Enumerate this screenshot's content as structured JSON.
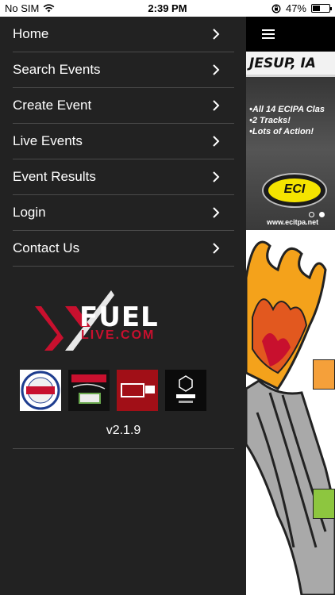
{
  "status_bar": {
    "carrier": "No SIM",
    "time": "2:39 PM",
    "battery_percent": "47%",
    "battery_level": 0.47
  },
  "drawer": {
    "menu": [
      {
        "label": "Home"
      },
      {
        "label": "Search Events"
      },
      {
        "label": "Create Event"
      },
      {
        "label": "Live Events"
      },
      {
        "label": "Event Results"
      },
      {
        "label": "Login"
      },
      {
        "label": "Contact Us"
      }
    ],
    "logo": {
      "main": "FUEL",
      "sub": "LIVE.COM"
    },
    "sponsors": [
      {
        "name": "united-states-pullers-association-logo"
      },
      {
        "name": "beer-money-pulling-team-logo"
      },
      {
        "name": "ppp-tv-logo"
      },
      {
        "name": "mlm-media-logo"
      }
    ],
    "version": "v2.1.9"
  },
  "main": {
    "banner": {
      "city": "JESUP, IA",
      "lines": [
        "•All 14 ECIPA Clas",
        "•2 Tracks!",
        "•Lots of Action!"
      ],
      "badge_text": "ECI",
      "url": "www.ecitpa.net"
    }
  },
  "colors": {
    "drawer_bg": "#222222",
    "divider": "#4a4a4a",
    "brand_red": "#c8102e",
    "accent_yellow": "#f4e300"
  }
}
